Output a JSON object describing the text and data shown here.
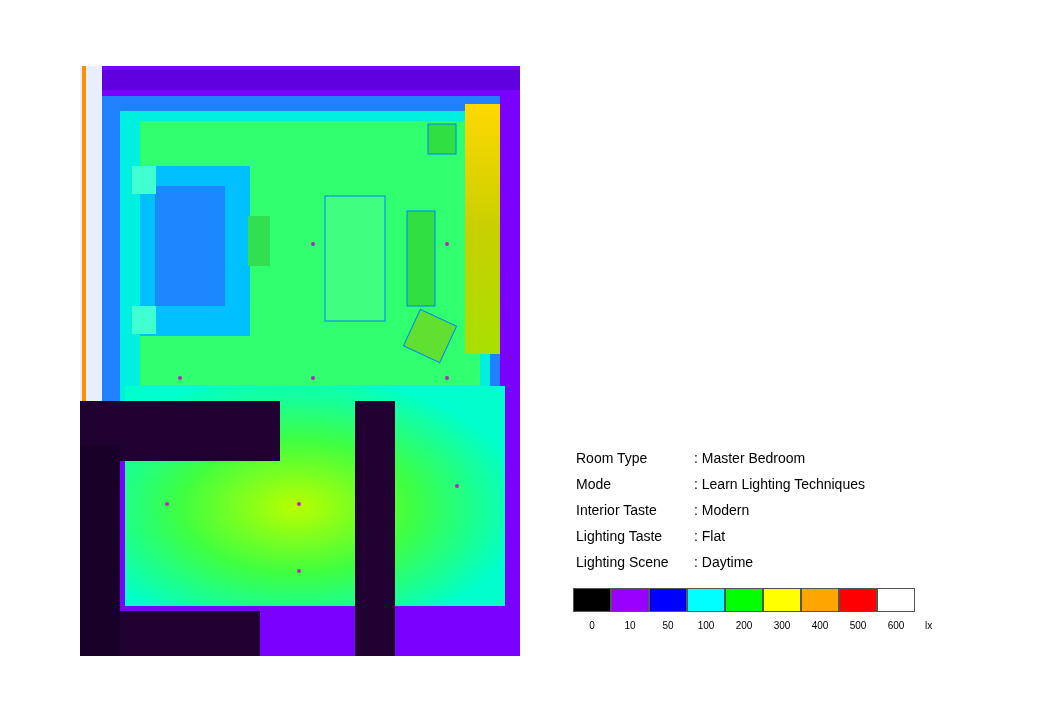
{
  "info": [
    {
      "label": "Room Type",
      "value": ": Master Bedroom"
    },
    {
      "label": "Mode",
      "value": ": Learn Lighting Techniques"
    },
    {
      "label": "Interior Taste",
      "value": ": Modern"
    },
    {
      "label": "Lighting Taste",
      "value": ": Flat"
    },
    {
      "label": "Lighting Scene",
      "value": ": Daytime"
    }
  ],
  "legend": {
    "unit": "lx",
    "steps": [
      {
        "value": "0",
        "color": "#000000"
      },
      {
        "value": "10",
        "color": "#9900ff"
      },
      {
        "value": "50",
        "color": "#0000ff"
      },
      {
        "value": "100",
        "color": "#00ffff"
      },
      {
        "value": "200",
        "color": "#00ff00"
      },
      {
        "value": "300",
        "color": "#ffff00"
      },
      {
        "value": "400",
        "color": "#ffa500"
      },
      {
        "value": "500",
        "color": "#ff0000"
      },
      {
        "value": "600",
        "color": "#ffffff"
      }
    ]
  }
}
